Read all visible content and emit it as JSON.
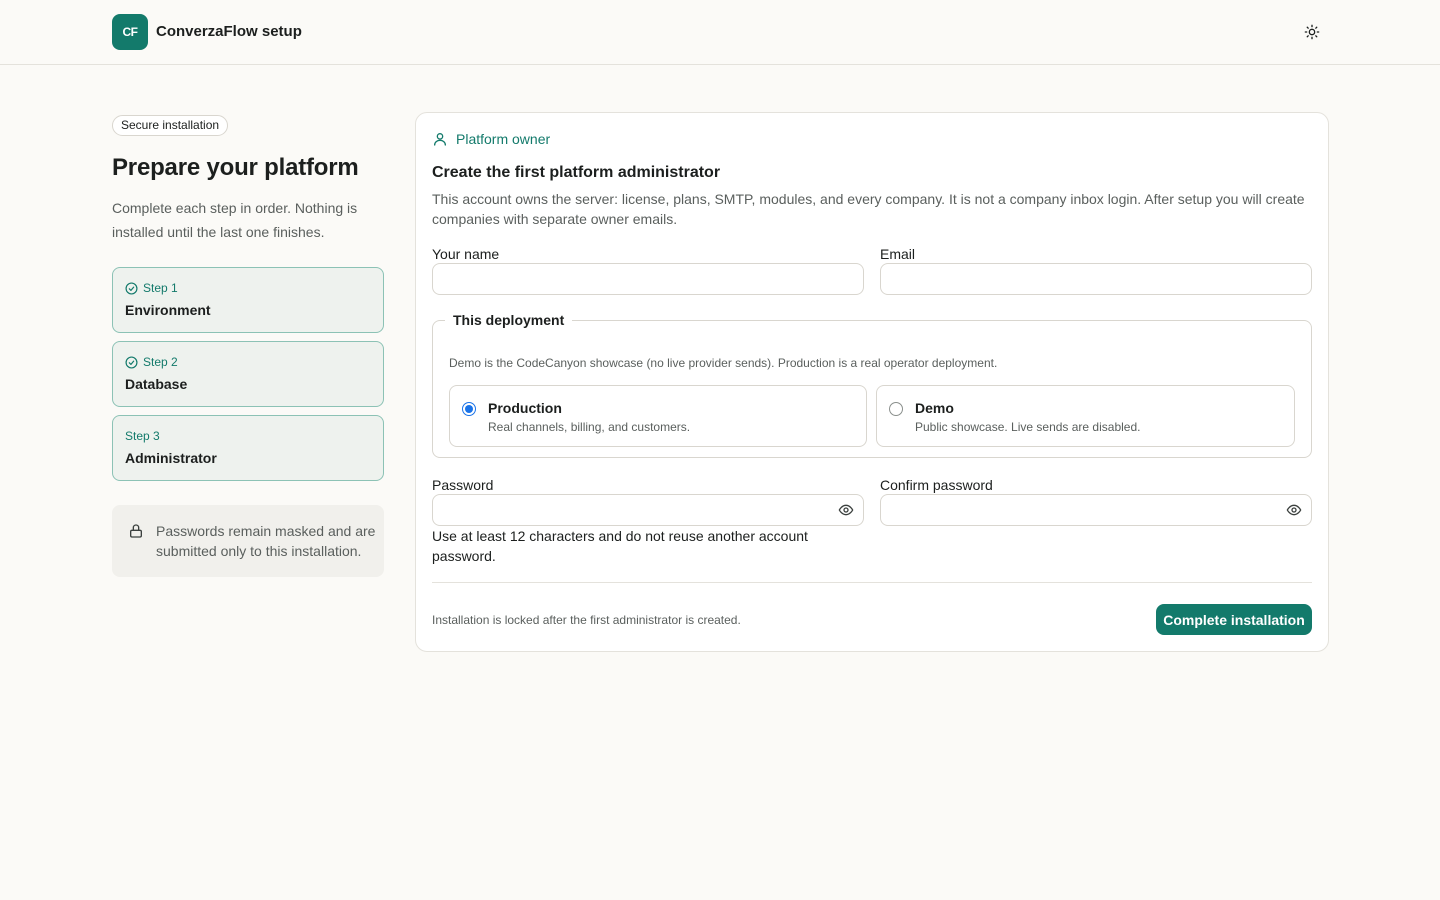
{
  "header": {
    "logo_text": "CF",
    "title": "ConverzaFlow setup",
    "theme_icon": "sun-icon"
  },
  "sidebar": {
    "badge": "Secure installation",
    "title": "Prepare your platform",
    "subtitle": "Complete each step in order. Nothing is installed until the last one finishes.",
    "steps": [
      {
        "number": "Step 1",
        "name": "Environment",
        "complete": true
      },
      {
        "number": "Step 2",
        "name": "Database",
        "complete": true
      },
      {
        "number": "Step 3",
        "name": "Administrator",
        "complete": false
      }
    ],
    "note": "Passwords remain masked and are submitted only to this installation."
  },
  "card": {
    "eyebrow": "Platform owner",
    "title": "Create the first platform administrator",
    "description": "This account owns the server: license, plans, SMTP, modules, and every company. It is not a company inbox login. After setup you will create companies with separate owner emails.",
    "fields": {
      "name_label": "Your name",
      "name_value": "",
      "email_label": "Email",
      "email_value": "",
      "password_label": "Password",
      "password_value": "",
      "confirm_label": "Confirm password",
      "confirm_value": ""
    },
    "deployment": {
      "legend": "This deployment",
      "description": "Demo is the CodeCanyon showcase (no live provider sends). Production is a real operator deployment.",
      "options": [
        {
          "title": "Production",
          "desc": "Real channels, billing, and customers.",
          "selected": true
        },
        {
          "title": "Demo",
          "desc": "Public showcase. Live sends are disabled.",
          "selected": false
        }
      ]
    },
    "password_hint": "Use at least 12 characters and do not reuse another account password.",
    "footer_note": "Installation is locked after the first administrator is created.",
    "submit_label": "Complete installation"
  },
  "colors": {
    "accent": "#137a6b",
    "background": "#fbfaf7",
    "step_bg": "#eef2ee",
    "radio_selected": "#1a73e8"
  }
}
